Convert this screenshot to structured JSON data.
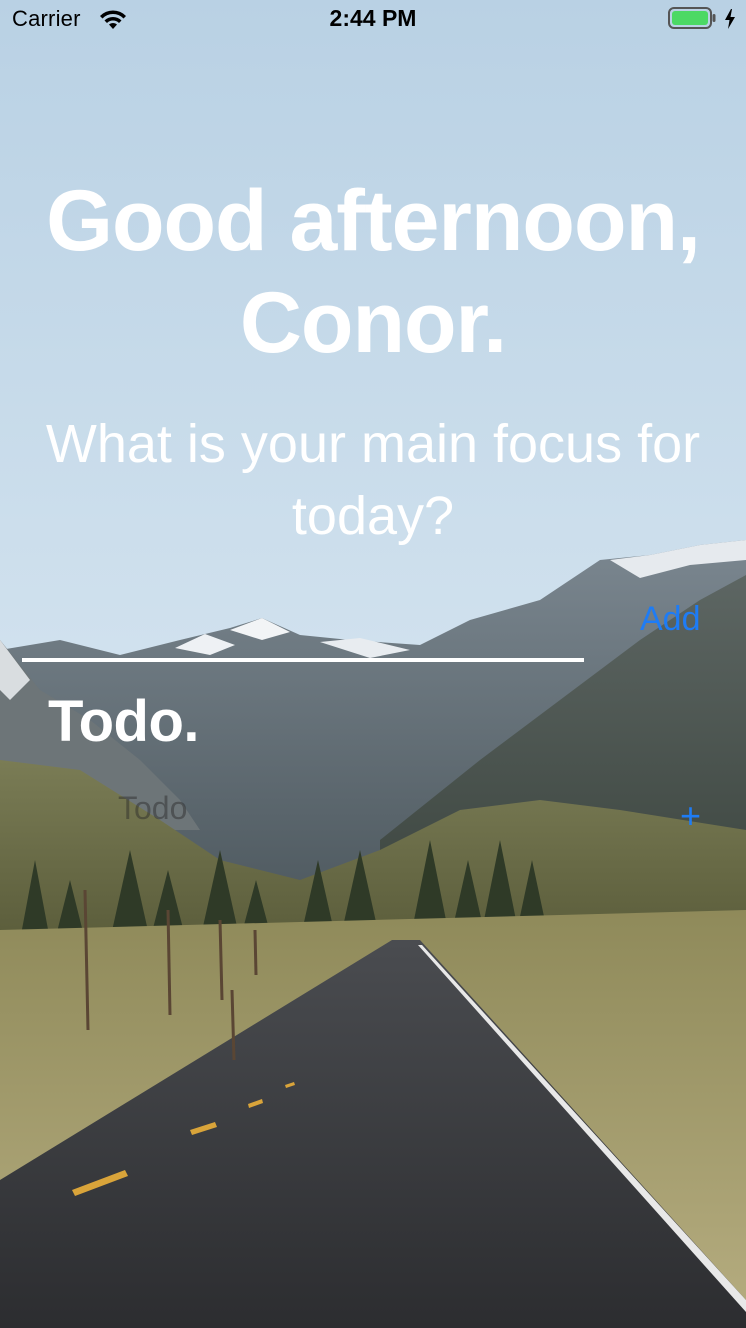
{
  "status_bar": {
    "carrier": "Carrier",
    "time": "2:44 PM",
    "battery_color": "#4cd964"
  },
  "greeting": {
    "line1": "Good afternoon,",
    "line2": "Conor."
  },
  "prompt": "What is your main focus for today?",
  "focus_input": {
    "value": "",
    "add_label": "Add"
  },
  "todo": {
    "heading": "Todo.",
    "placeholder": "Todo",
    "add_label": "+"
  },
  "colors": {
    "accent": "#1e7cf5",
    "text": "#ffffff",
    "sky": "#cfe0ec"
  },
  "icons": {
    "wifi": "wifi-icon",
    "battery": "battery-icon",
    "charging": "bolt-icon"
  }
}
